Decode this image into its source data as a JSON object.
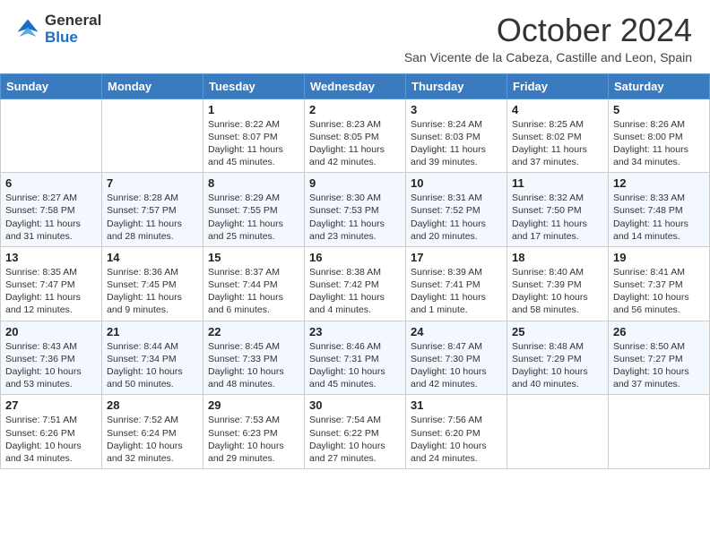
{
  "logo": {
    "general": "General",
    "blue": "Blue"
  },
  "title": "October 2024",
  "subtitle": "San Vicente de la Cabeza, Castille and Leon, Spain",
  "days_of_week": [
    "Sunday",
    "Monday",
    "Tuesday",
    "Wednesday",
    "Thursday",
    "Friday",
    "Saturday"
  ],
  "weeks": [
    [
      {
        "day": "",
        "sunrise": "",
        "sunset": "",
        "daylight": ""
      },
      {
        "day": "",
        "sunrise": "",
        "sunset": "",
        "daylight": ""
      },
      {
        "day": "1",
        "sunrise": "Sunrise: 8:22 AM",
        "sunset": "Sunset: 8:07 PM",
        "daylight": "Daylight: 11 hours and 45 minutes."
      },
      {
        "day": "2",
        "sunrise": "Sunrise: 8:23 AM",
        "sunset": "Sunset: 8:05 PM",
        "daylight": "Daylight: 11 hours and 42 minutes."
      },
      {
        "day": "3",
        "sunrise": "Sunrise: 8:24 AM",
        "sunset": "Sunset: 8:03 PM",
        "daylight": "Daylight: 11 hours and 39 minutes."
      },
      {
        "day": "4",
        "sunrise": "Sunrise: 8:25 AM",
        "sunset": "Sunset: 8:02 PM",
        "daylight": "Daylight: 11 hours and 37 minutes."
      },
      {
        "day": "5",
        "sunrise": "Sunrise: 8:26 AM",
        "sunset": "Sunset: 8:00 PM",
        "daylight": "Daylight: 11 hours and 34 minutes."
      }
    ],
    [
      {
        "day": "6",
        "sunrise": "Sunrise: 8:27 AM",
        "sunset": "Sunset: 7:58 PM",
        "daylight": "Daylight: 11 hours and 31 minutes."
      },
      {
        "day": "7",
        "sunrise": "Sunrise: 8:28 AM",
        "sunset": "Sunset: 7:57 PM",
        "daylight": "Daylight: 11 hours and 28 minutes."
      },
      {
        "day": "8",
        "sunrise": "Sunrise: 8:29 AM",
        "sunset": "Sunset: 7:55 PM",
        "daylight": "Daylight: 11 hours and 25 minutes."
      },
      {
        "day": "9",
        "sunrise": "Sunrise: 8:30 AM",
        "sunset": "Sunset: 7:53 PM",
        "daylight": "Daylight: 11 hours and 23 minutes."
      },
      {
        "day": "10",
        "sunrise": "Sunrise: 8:31 AM",
        "sunset": "Sunset: 7:52 PM",
        "daylight": "Daylight: 11 hours and 20 minutes."
      },
      {
        "day": "11",
        "sunrise": "Sunrise: 8:32 AM",
        "sunset": "Sunset: 7:50 PM",
        "daylight": "Daylight: 11 hours and 17 minutes."
      },
      {
        "day": "12",
        "sunrise": "Sunrise: 8:33 AM",
        "sunset": "Sunset: 7:48 PM",
        "daylight": "Daylight: 11 hours and 14 minutes."
      }
    ],
    [
      {
        "day": "13",
        "sunrise": "Sunrise: 8:35 AM",
        "sunset": "Sunset: 7:47 PM",
        "daylight": "Daylight: 11 hours and 12 minutes."
      },
      {
        "day": "14",
        "sunrise": "Sunrise: 8:36 AM",
        "sunset": "Sunset: 7:45 PM",
        "daylight": "Daylight: 11 hours and 9 minutes."
      },
      {
        "day": "15",
        "sunrise": "Sunrise: 8:37 AM",
        "sunset": "Sunset: 7:44 PM",
        "daylight": "Daylight: 11 hours and 6 minutes."
      },
      {
        "day": "16",
        "sunrise": "Sunrise: 8:38 AM",
        "sunset": "Sunset: 7:42 PM",
        "daylight": "Daylight: 11 hours and 4 minutes."
      },
      {
        "day": "17",
        "sunrise": "Sunrise: 8:39 AM",
        "sunset": "Sunset: 7:41 PM",
        "daylight": "Daylight: 11 hours and 1 minute."
      },
      {
        "day": "18",
        "sunrise": "Sunrise: 8:40 AM",
        "sunset": "Sunset: 7:39 PM",
        "daylight": "Daylight: 10 hours and 58 minutes."
      },
      {
        "day": "19",
        "sunrise": "Sunrise: 8:41 AM",
        "sunset": "Sunset: 7:37 PM",
        "daylight": "Daylight: 10 hours and 56 minutes."
      }
    ],
    [
      {
        "day": "20",
        "sunrise": "Sunrise: 8:43 AM",
        "sunset": "Sunset: 7:36 PM",
        "daylight": "Daylight: 10 hours and 53 minutes."
      },
      {
        "day": "21",
        "sunrise": "Sunrise: 8:44 AM",
        "sunset": "Sunset: 7:34 PM",
        "daylight": "Daylight: 10 hours and 50 minutes."
      },
      {
        "day": "22",
        "sunrise": "Sunrise: 8:45 AM",
        "sunset": "Sunset: 7:33 PM",
        "daylight": "Daylight: 10 hours and 48 minutes."
      },
      {
        "day": "23",
        "sunrise": "Sunrise: 8:46 AM",
        "sunset": "Sunset: 7:31 PM",
        "daylight": "Daylight: 10 hours and 45 minutes."
      },
      {
        "day": "24",
        "sunrise": "Sunrise: 8:47 AM",
        "sunset": "Sunset: 7:30 PM",
        "daylight": "Daylight: 10 hours and 42 minutes."
      },
      {
        "day": "25",
        "sunrise": "Sunrise: 8:48 AM",
        "sunset": "Sunset: 7:29 PM",
        "daylight": "Daylight: 10 hours and 40 minutes."
      },
      {
        "day": "26",
        "sunrise": "Sunrise: 8:50 AM",
        "sunset": "Sunset: 7:27 PM",
        "daylight": "Daylight: 10 hours and 37 minutes."
      }
    ],
    [
      {
        "day": "27",
        "sunrise": "Sunrise: 7:51 AM",
        "sunset": "Sunset: 6:26 PM",
        "daylight": "Daylight: 10 hours and 34 minutes."
      },
      {
        "day": "28",
        "sunrise": "Sunrise: 7:52 AM",
        "sunset": "Sunset: 6:24 PM",
        "daylight": "Daylight: 10 hours and 32 minutes."
      },
      {
        "day": "29",
        "sunrise": "Sunrise: 7:53 AM",
        "sunset": "Sunset: 6:23 PM",
        "daylight": "Daylight: 10 hours and 29 minutes."
      },
      {
        "day": "30",
        "sunrise": "Sunrise: 7:54 AM",
        "sunset": "Sunset: 6:22 PM",
        "daylight": "Daylight: 10 hours and 27 minutes."
      },
      {
        "day": "31",
        "sunrise": "Sunrise: 7:56 AM",
        "sunset": "Sunset: 6:20 PM",
        "daylight": "Daylight: 10 hours and 24 minutes."
      },
      {
        "day": "",
        "sunrise": "",
        "sunset": "",
        "daylight": ""
      },
      {
        "day": "",
        "sunrise": "",
        "sunset": "",
        "daylight": ""
      }
    ]
  ]
}
